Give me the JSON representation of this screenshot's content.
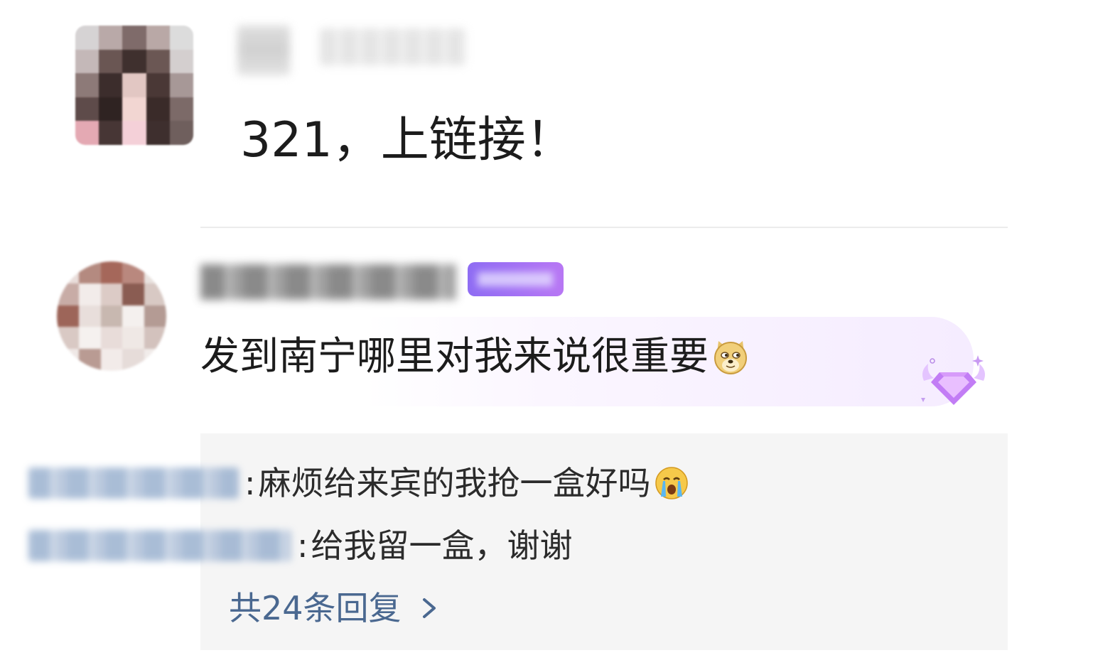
{
  "post": {
    "text": "321，上链接！"
  },
  "comment": {
    "text": "发到南宁哪里对我来说很重要",
    "emoji": "doge-emoji-icon"
  },
  "replies": {
    "items": [
      {
        "text": "麻烦给来宾的我抢一盒好吗",
        "emoji": "crying-face-icon"
      },
      {
        "text": "给我留一盒，谢谢"
      }
    ],
    "more_label": "共24条回复"
  },
  "colors": {
    "link": "#4a6890",
    "badge_start": "#8e6cf3",
    "badge_end": "#b877f4",
    "panel_bg": "#f5f5f5"
  }
}
